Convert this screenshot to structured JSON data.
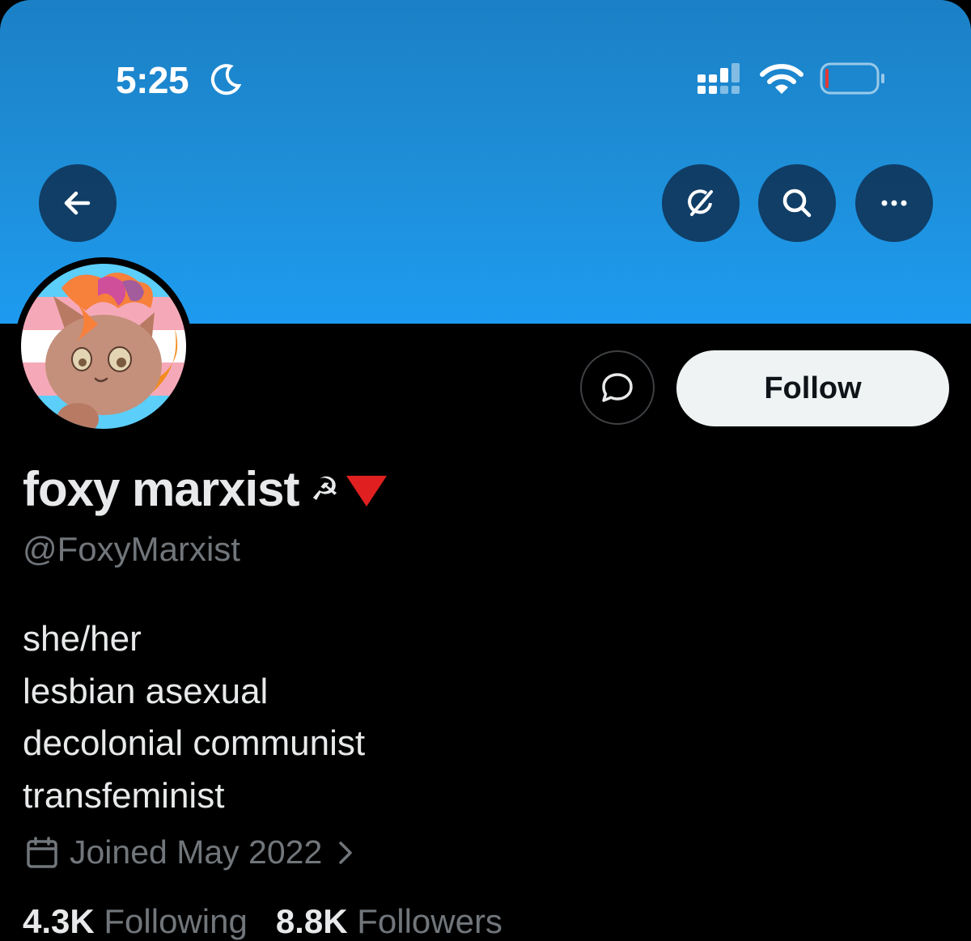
{
  "status_bar": {
    "time": "5:25"
  },
  "profile": {
    "display_name": "foxy marxist",
    "name_emoji_1": "☭",
    "handle": "@FoxyMarxist",
    "bio_lines": [
      "she/her",
      "lesbian asexual",
      "decolonial communist",
      "transfeminist"
    ],
    "joined": "Joined May 2022",
    "following_count": "4.3K",
    "following_label": "Following",
    "followers_count": "8.8K",
    "followers_label": "Followers"
  },
  "actions": {
    "follow_label": "Follow"
  },
  "icons": {
    "back": "arrow-left-icon",
    "grok": "grok-icon",
    "search": "search-icon",
    "more": "more-icon",
    "message": "message-icon",
    "calendar": "calendar-icon"
  },
  "colors": {
    "banner": "#1d9bf0",
    "follow_bg": "#eff3f4",
    "secondary_text": "#71767b"
  }
}
